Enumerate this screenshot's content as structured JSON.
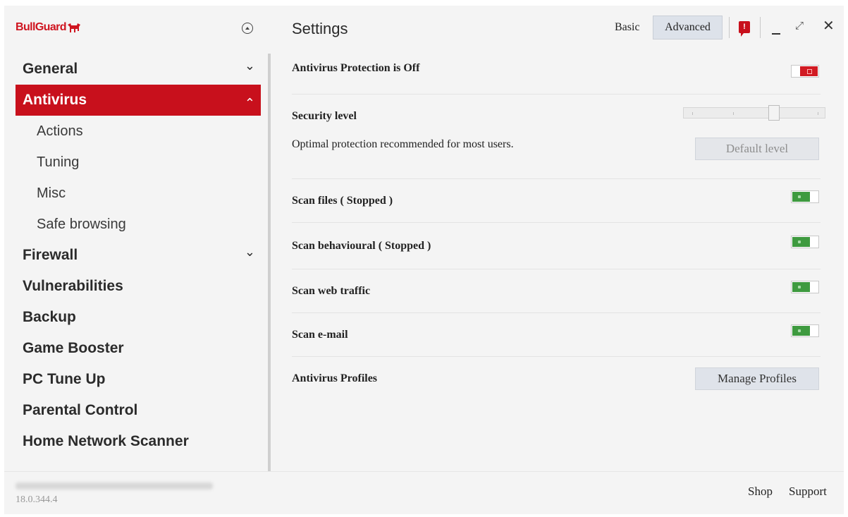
{
  "app": {
    "logo_text": "BullGuard",
    "brand_color": "#c8101c",
    "toggle_on_color": "#3e9a3f",
    "toggle_off_color": "#d11a22"
  },
  "header": {
    "title": "Settings",
    "mode_basic": "Basic",
    "mode_advanced": "Advanced",
    "mode_selected": "Advanced",
    "notification_count": "!",
    "restore_glyph": "⤢",
    "close_glyph": "✕"
  },
  "sidebar": {
    "items": [
      {
        "label": "General",
        "chevron": "down",
        "active": false
      },
      {
        "label": "Antivirus",
        "chevron": "up",
        "active": true
      },
      {
        "label": "Actions",
        "sub": true
      },
      {
        "label": "Tuning",
        "sub": true
      },
      {
        "label": "Misc",
        "sub": true
      },
      {
        "label": "Safe browsing",
        "sub": true
      },
      {
        "label": "Firewall",
        "chevron": "down",
        "active": false
      },
      {
        "label": "Vulnerabilities",
        "active": false
      },
      {
        "label": "Backup",
        "active": false
      },
      {
        "label": "Game Booster",
        "active": false
      },
      {
        "label": "PC Tune Up",
        "active": false
      },
      {
        "label": "Parental Control",
        "active": false
      },
      {
        "label": "Home Network Scanner",
        "active": false
      }
    ]
  },
  "content": {
    "protection_status": {
      "label": "Antivirus Protection is Off",
      "enabled": false
    },
    "security_level": {
      "label": "Security level",
      "description": "Optimal protection recommended for most users.",
      "default_button": "Default level"
    },
    "scan_files": {
      "label": "Scan files ( Stopped )",
      "enabled": true
    },
    "scan_behavioural": {
      "label": "Scan behavioural ( Stopped )",
      "enabled": true
    },
    "scan_web": {
      "label": "Scan web traffic",
      "enabled": true
    },
    "scan_email": {
      "label": "Scan e-mail",
      "enabled": true
    },
    "profiles": {
      "label": "Antivirus Profiles",
      "button": "Manage Profiles"
    }
  },
  "footer": {
    "version": "18.0.344.4",
    "shop": "Shop",
    "support": "Support"
  }
}
